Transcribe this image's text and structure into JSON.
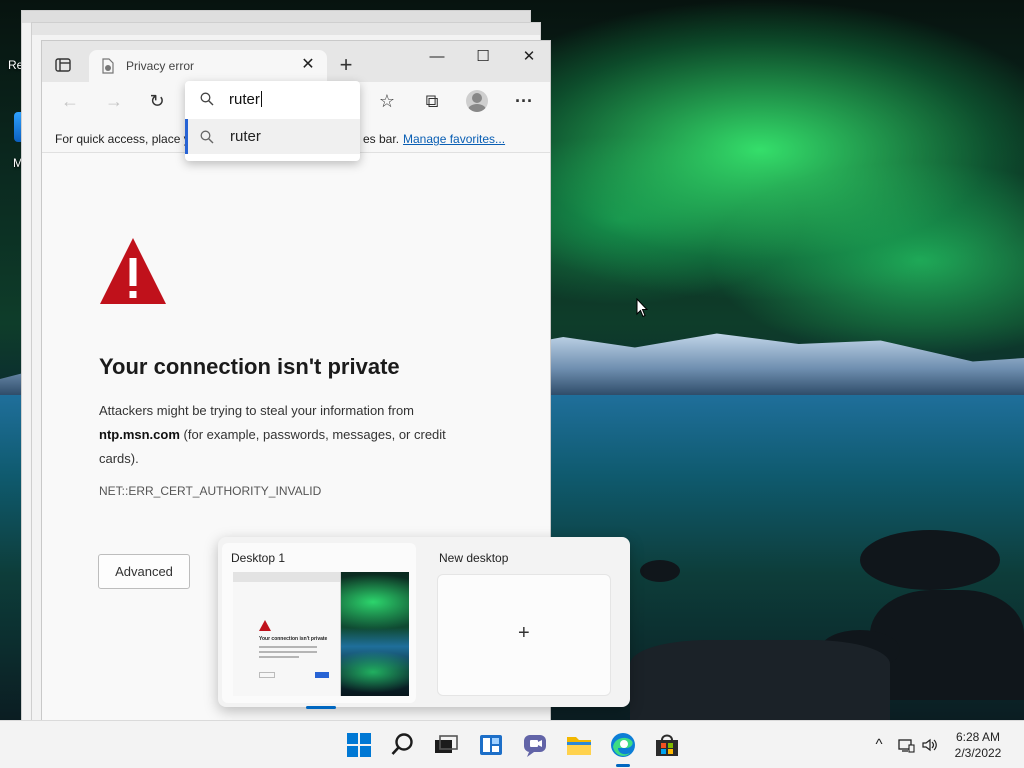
{
  "desktop": {
    "icon_label_1": "Re",
    "icon_label_2": "M"
  },
  "browser": {
    "tab": {
      "title": "Privacy error"
    },
    "window_controls": {
      "minimize": "—",
      "maximize": "☐",
      "close": "✕"
    },
    "favorites_bar": {
      "message_part1": "For quick access, place y",
      "message_part2": "es bar.",
      "manage_link": "Manage favorites..."
    },
    "address_suggest": {
      "input_value": "ruter",
      "suggestion": "ruter"
    },
    "page": {
      "heading": "Your connection isn't private",
      "desc_line1": "Attackers might be trying to steal your information from",
      "domain": "ntp.msn.com",
      "desc_line2": " (for example, passwords, messages, or credit",
      "desc_line3": "cards).",
      "error_code": "NET::ERR_CERT_AUTHORITY_INVALID",
      "advanced_button": "Advanced"
    }
  },
  "taskview": {
    "desktops": [
      {
        "label": "Desktop 1",
        "active": true
      },
      {
        "label": "New desktop"
      }
    ],
    "new_desktop_plus": "+",
    "thumbnail_heading": "Your connection isn't private"
  },
  "taskbar": {
    "icons": [
      "windows-start-icon",
      "search-icon",
      "task-view-icon",
      "widgets-icon",
      "chat-icon",
      "file-explorer-icon",
      "edge-icon",
      "store-icon"
    ],
    "tray": {
      "chevron": "^"
    },
    "time": "6:28 AM",
    "date": "2/3/2022"
  },
  "colors": {
    "accent": "#0067c0",
    "warning_red": "#c0111b",
    "link": "#0a5fb4"
  }
}
